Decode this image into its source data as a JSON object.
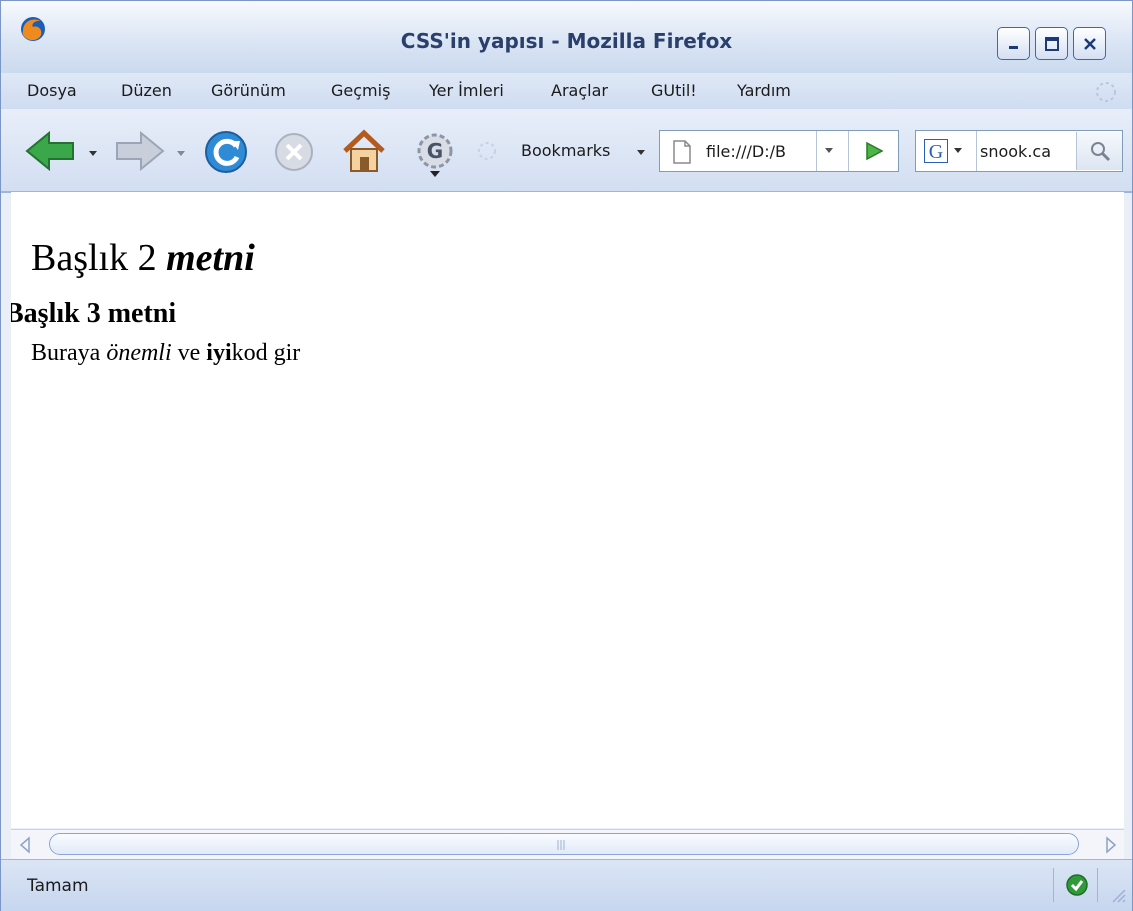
{
  "window": {
    "title": "CSS'in yapısı - Mozilla Firefox"
  },
  "menu": {
    "items": [
      "Dosya",
      "Düzen",
      "Görünüm",
      "Geçmiş",
      "Yer İmleri",
      "Araçlar",
      "GUtil!",
      "Yardım"
    ]
  },
  "toolbar": {
    "bookmarks_label": "Bookmarks",
    "url_value": "file:///D:/B",
    "search_value": "snook.ca"
  },
  "content": {
    "heading2_plain": "Başlık 2",
    "heading2_italic": "metni",
    "heading3": "Başlık 3 metni",
    "para_part1": "Buraya",
    "para_em": "önemli",
    "para_part2": "ve",
    "para_bold": "iyi",
    "para_part3": "kod gir"
  },
  "status": {
    "text": "Tamam"
  },
  "icons": {
    "app": "firefox-icon",
    "back": "back-arrow-icon",
    "forward": "forward-arrow-icon",
    "reload": "reload-icon",
    "stop": "stop-icon",
    "home": "home-icon",
    "gutil": "gutil-icon",
    "go": "go-icon",
    "search_engine": "google-icon",
    "search": "magnifier-icon",
    "secure": "check-icon"
  },
  "colors": {
    "title_text": "#2a3f6b",
    "accent": "#7b96c6",
    "back_green": "#3aa84a",
    "reload_blue": "#2f8bd6"
  }
}
